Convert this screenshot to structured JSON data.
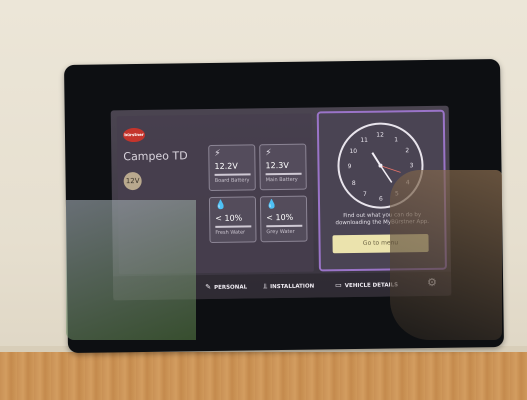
{
  "vehicle": {
    "brand_logo": "bürstner",
    "model_name": "Campeo TD",
    "voltage_badge": "12V"
  },
  "tiles": [
    {
      "icon": "bolt-icon",
      "value": "12.2V",
      "label": "Board Battery"
    },
    {
      "icon": "bolt-icon",
      "value": "12.3V",
      "label": "Main Battery"
    },
    {
      "icon": "drop-icon",
      "value": "< 10%",
      "label": "Fresh Water"
    },
    {
      "icon": "drop-icon",
      "value": "< 10%",
      "label": "Grey Water"
    }
  ],
  "promo": {
    "line1": "Find out what you can do by",
    "line2": "downloading the MyBürstner App.",
    "button_label": "Go to menu"
  },
  "nav": {
    "personal": "PERSONAL",
    "installation": "INSTALLATION",
    "vehicle_details": "VEHICLE DETAILS"
  },
  "colors": {
    "accent_purple": "#9a74c8",
    "menu_button": "#ebe3ad",
    "logo_red": "#c4342c"
  }
}
